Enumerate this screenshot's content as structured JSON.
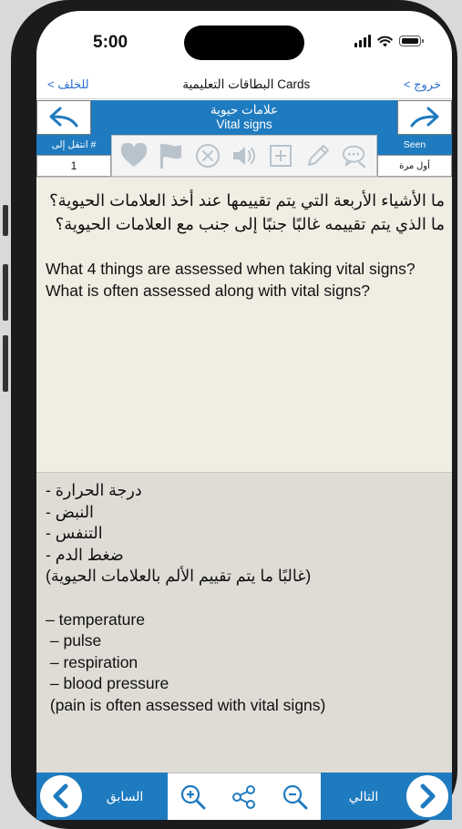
{
  "status": {
    "time": "5:00"
  },
  "navbar": {
    "back": "< للخلف",
    "title": "البطاقات التعليمية Cards",
    "exit": "< خروج"
  },
  "deck": {
    "title_ar": "علامات حيوية",
    "title_en": "Vital signs"
  },
  "toolbar": {
    "goto_label": "انتقل إلى #",
    "goto_value": "1",
    "seen_label": "Seen",
    "seen_value": "أول مرة",
    "icons": [
      "heart-icon",
      "flag-icon",
      "delete-icon",
      "speaker-icon",
      "add-card-icon",
      "edit-icon",
      "comment-icon"
    ]
  },
  "question": {
    "arabic": "ما الأشياء الأربعة التي يتم تقييمها عند أخذ العلامات الحيوية؟ ما الذي يتم تقييمه غالبًا جنبًا إلى جنب مع العلامات الحيوية؟",
    "english": "What 4 things are assessed when taking vital signs?  What is often assessed along with vital signs?"
  },
  "answer": {
    "arabic_lines": [
      "درجة الحرارة -",
      "النبض -",
      "التنفس -",
      "ضغط الدم -",
      "(غالبًا ما يتم تقييم الألم بالعلامات الحيوية)"
    ],
    "english_lines": [
      "– temperature",
      " – pulse",
      " – respiration",
      " – blood pressure",
      " (pain is often assessed with vital signs)"
    ]
  },
  "bottom": {
    "previous": "السابق",
    "next": "التالي"
  },
  "colors": {
    "accent": "#1f7bbf",
    "question_bg": "#f0ede3",
    "answer_bg": "#dedcd5"
  }
}
